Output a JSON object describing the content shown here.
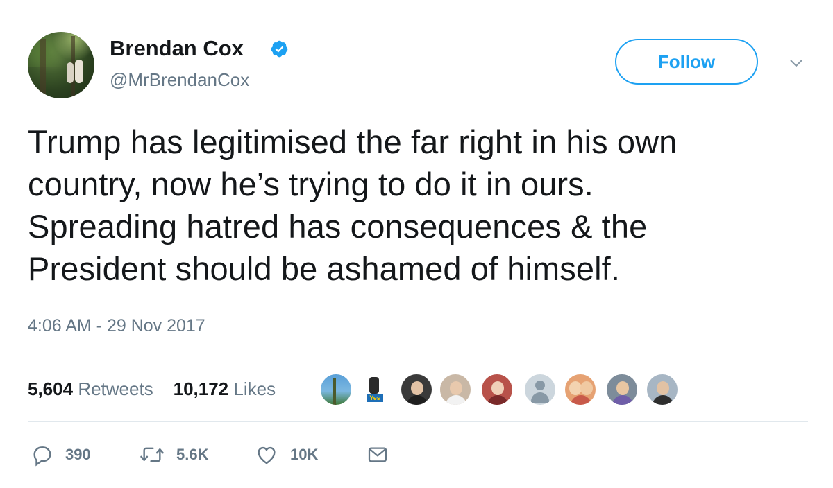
{
  "author": {
    "name": "Brendan Cox",
    "handle": "@MrBrendanCox",
    "verified": true
  },
  "follow_button": {
    "label": "Follow"
  },
  "tweet": {
    "lines": [
      "Trump has legitimised the far right in his own",
      "country, now he’s trying to do it in ours.",
      "Spreading hatred has consequences & the",
      "President should be ashamed of himself."
    ],
    "timestamp": "4:06 AM - 29 Nov 2017"
  },
  "stats": {
    "retweets_count": "5,604",
    "retweets_label": "Retweets",
    "likes_count": "10,172",
    "likes_label": "Likes"
  },
  "actions": {
    "reply_count": "390",
    "retweet_count": "5.6K",
    "like_count": "10K"
  },
  "colors": {
    "accent": "#1da1f2",
    "text": "#14171a",
    "muted": "#657786",
    "divider": "#e1e8ed"
  }
}
